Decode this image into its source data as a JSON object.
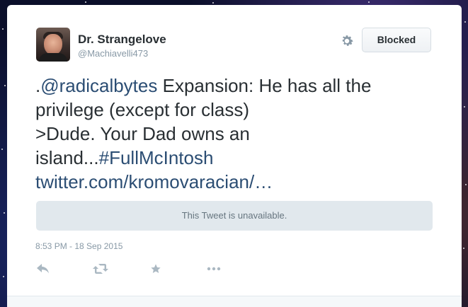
{
  "tweet": {
    "author_name": "Dr. Strangelove",
    "author_handle": "@Machiavelli473",
    "follow_button_label": "Blocked",
    "text_prefix": ".",
    "mention": "@radicalbytes",
    "text_line_1_rest": " Expansion: He has all the",
    "text_line_2": "privilege (except for class)",
    "text_line_3": ">Dude. Your Dad owns an",
    "text_line_4_start": "island...",
    "hashtag": "#FullMcIntosh",
    "url": "twitter.com/kromovaracian/…",
    "embedded_notice": "This Tweet is unavailable.",
    "timestamp": "8:53 PM - 18 Sep 2015"
  },
  "icons": {
    "settings": "gear-icon",
    "reply": "reply-icon",
    "retweet": "retweet-icon",
    "favorite": "star-icon",
    "more": "more-icon"
  },
  "colors": {
    "link": "#2b4d73",
    "text": "#292f33",
    "muted": "#8899a6",
    "icon": "#aab8c2"
  }
}
